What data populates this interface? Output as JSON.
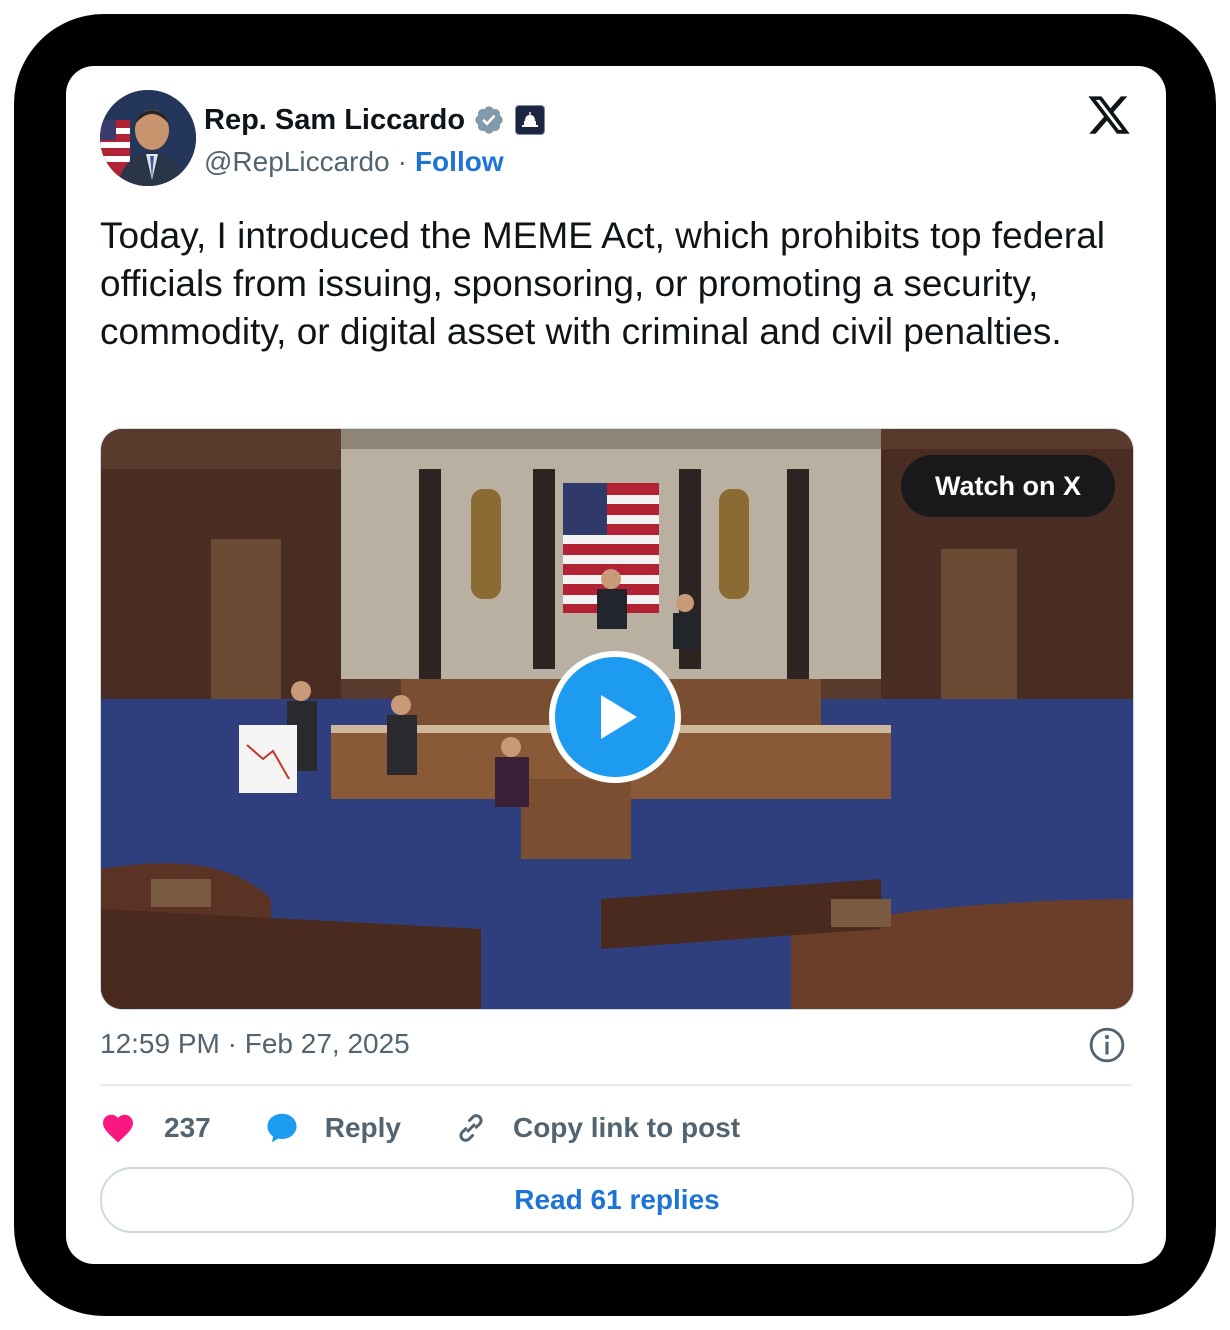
{
  "author": {
    "name": "Rep. Sam Liccardo",
    "handle": "@RepLiccardo",
    "follow_label": "Follow"
  },
  "icons": {
    "verified": "verified-badge-icon",
    "gov_badge": "capitol-icon",
    "platform": "x-logo-icon",
    "info": "info-icon",
    "like": "heart-icon",
    "reply": "reply-bubble-icon",
    "copy": "link-icon"
  },
  "tweet": {
    "text": "Today, I introduced the MEME Act, which prohibits top federal officials from issuing, sponsoring, or promoting a security, commodity, or digital asset with criminal and civil penalties.",
    "timestamp": "12:59 PM · Feb 27, 2025"
  },
  "media": {
    "watch_label": "Watch on X"
  },
  "actions": {
    "like_count": "237",
    "reply_label": "Reply",
    "copy_label": "Copy link to post"
  },
  "footer": {
    "read_replies_label": "Read 61 replies"
  },
  "colors": {
    "accent": "#1d74d6",
    "play": "#1d9bf0",
    "heart": "#f91880"
  }
}
